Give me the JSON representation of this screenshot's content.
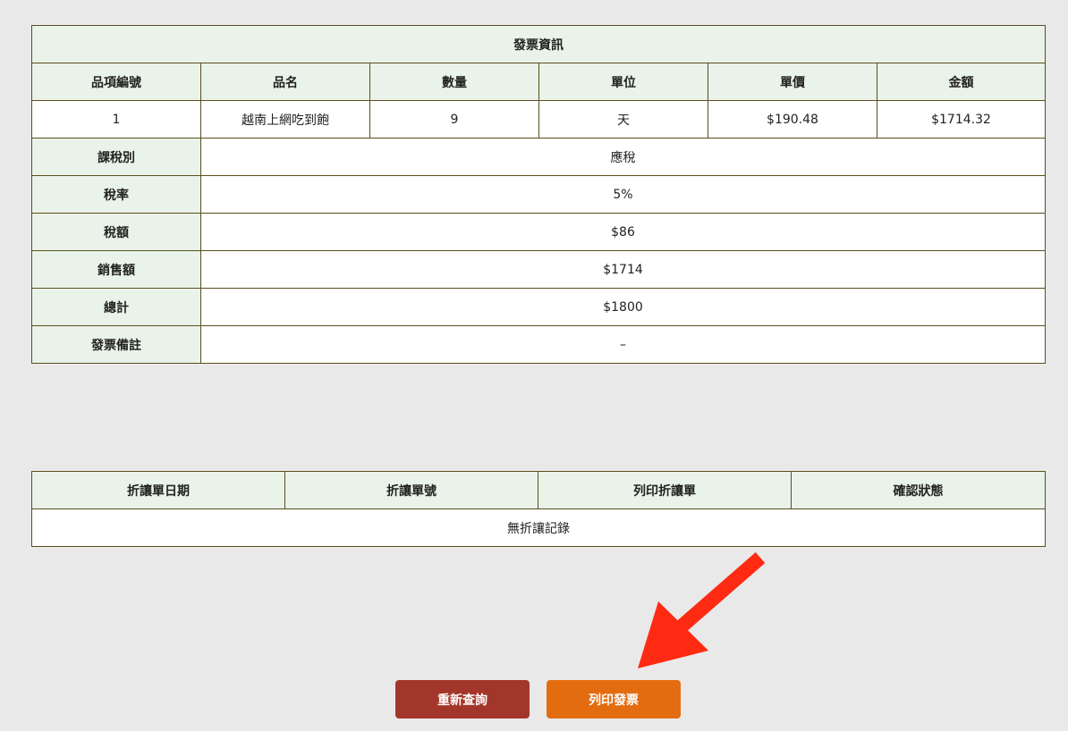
{
  "invoice": {
    "title": "發票資訊",
    "columns": [
      "品項編號",
      "品名",
      "數量",
      "單位",
      "單價",
      "金額"
    ],
    "items": [
      {
        "no": "1",
        "name": "越南上網吃到飽",
        "qty": "9",
        "unit": "天",
        "unit_price": "$190.48",
        "amount": "$1714.32"
      }
    ],
    "summary": [
      {
        "label": "課稅別",
        "value": "應稅"
      },
      {
        "label": "稅率",
        "value": "5%"
      },
      {
        "label": "稅額",
        "value": "$86"
      },
      {
        "label": "銷售額",
        "value": "$1714"
      },
      {
        "label": "總計",
        "value": "$1800"
      },
      {
        "label": "發票備註",
        "value": "–"
      }
    ]
  },
  "discount": {
    "columns": [
      "折讓單日期",
      "折讓單號",
      "列印折讓單",
      "確認狀態"
    ],
    "empty_message": "無折讓記錄"
  },
  "buttons": {
    "requery": "重新查詢",
    "print_invoice": "列印發票"
  },
  "colors": {
    "page_bg": "#eae9e9",
    "header_bg": "#e9f3e9",
    "border": "#5a4e1e",
    "requery_button": "#a3362a",
    "print_button": "#e46c10",
    "annotation_arrow": "#ff2a12"
  },
  "annotation": {
    "icon": "red-arrow-icon"
  }
}
